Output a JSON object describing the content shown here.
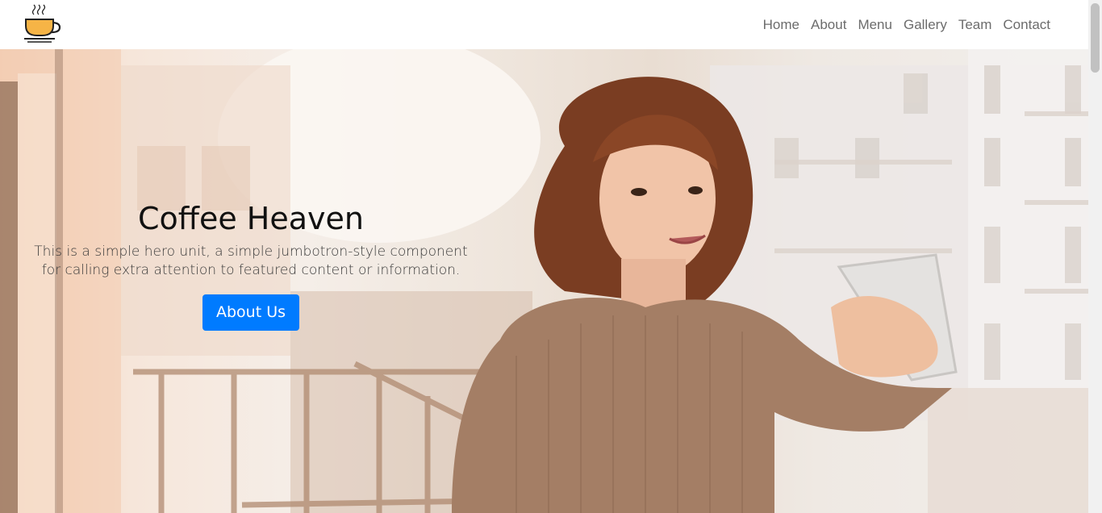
{
  "navbar": {
    "logo_icon": "coffee-cup-icon",
    "links": [
      {
        "label": "Home"
      },
      {
        "label": "About"
      },
      {
        "label": "Menu"
      },
      {
        "label": "Gallery"
      },
      {
        "label": "Team"
      },
      {
        "label": "Contact"
      }
    ]
  },
  "hero": {
    "title": "Coffee Heaven",
    "lead": "This is a simple hero unit, a simple jumbotron-style component for calling extra attention to featured content or information.",
    "button_label": "About Us",
    "image_icon": "woman-with-coffee-photo"
  },
  "colors": {
    "primary": "#007bff",
    "nav_text": "#6c6c6c",
    "title": "#111111"
  }
}
